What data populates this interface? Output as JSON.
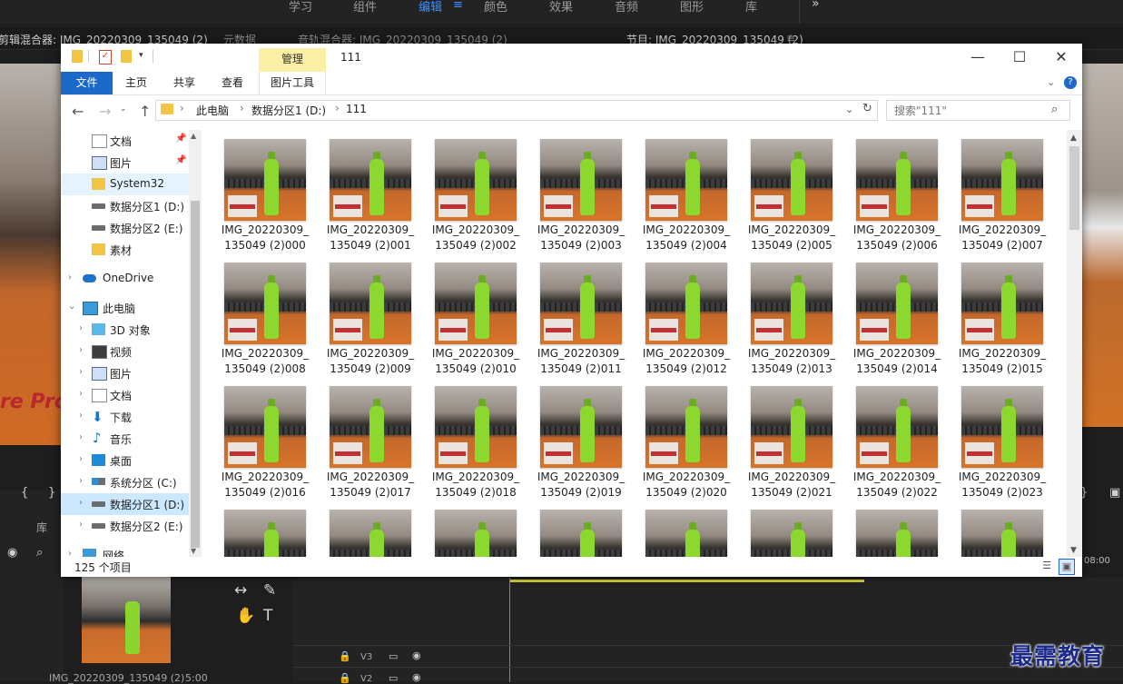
{
  "premiere": {
    "workspace_tabs": [
      "学习",
      "组件",
      "编辑",
      "颜色",
      "效果",
      "音频",
      "图形",
      "库"
    ],
    "active_workspace": "编辑",
    "more_label": "»",
    "panel_titles": {
      "effect_controls": "剪辑混合器: IMG_20220309_135049 (2)",
      "metadata": "元数据",
      "audio_mixer": "音轨混合器: IMG_20220309_135049 (2)",
      "program": "节目: IMG_20220309_135049 (2)"
    },
    "library_tab": "库",
    "project_clip_name": "IMG_20220309_135049 (2)",
    "project_clip_duration": "5:00",
    "timecode": "08:00",
    "tracks": [
      "V3",
      "V2"
    ],
    "left_text": "re Pro"
  },
  "watermark": "最需教育",
  "explorer": {
    "title": "111",
    "manage_tab": "管理",
    "ribbon_tabs": {
      "file": "文件",
      "home": "主页",
      "share": "共享",
      "view": "查看",
      "picture_tools": "图片工具"
    },
    "window_buttons": {
      "minimize": "—",
      "maximize": "☐",
      "close": "✕"
    },
    "breadcrumb": [
      "此电脑",
      "数据分区1 (D:)",
      "111"
    ],
    "search_placeholder": "搜索\"111\"",
    "nav_items": [
      {
        "label": "文档",
        "icon": "document-icon",
        "pinned": true
      },
      {
        "label": "图片",
        "icon": "picture-icon",
        "pinned": true
      },
      {
        "label": "System32",
        "icon": "folder-icon",
        "pinned": false
      },
      {
        "label": "数据分区1 (D:)",
        "icon": "drive-icon",
        "pinned": false
      },
      {
        "label": "数据分区2 (E:)",
        "icon": "drive-icon",
        "pinned": false
      },
      {
        "label": "素材",
        "icon": "folder-icon",
        "pinned": false
      },
      {
        "label": "OneDrive",
        "icon": "cloud-icon",
        "pinned": false
      },
      {
        "label": "此电脑",
        "icon": "computer-icon",
        "pinned": false
      },
      {
        "label": "3D 对象",
        "icon": "cube-icon",
        "pinned": false
      },
      {
        "label": "视频",
        "icon": "video-icon",
        "pinned": false
      },
      {
        "label": "图片",
        "icon": "picture-icon",
        "pinned": false
      },
      {
        "label": "文档",
        "icon": "document-icon",
        "pinned": false
      },
      {
        "label": "下载",
        "icon": "download-icon",
        "pinned": false
      },
      {
        "label": "音乐",
        "icon": "music-icon",
        "pinned": false
      },
      {
        "label": "桌面",
        "icon": "desktop-icon",
        "pinned": false
      },
      {
        "label": "系统分区 (C:)",
        "icon": "system-drive-icon",
        "pinned": false
      },
      {
        "label": "数据分区1 (D:)",
        "icon": "drive-icon",
        "pinned": false
      },
      {
        "label": "数据分区2 (E:)",
        "icon": "drive-icon",
        "pinned": false
      },
      {
        "label": "网络",
        "icon": "network-icon",
        "pinned": false
      }
    ],
    "files": [
      {
        "line1": "IMG_20220309_",
        "line2": "135049 (2)000"
      },
      {
        "line1": "IMG_20220309_",
        "line2": "135049 (2)001"
      },
      {
        "line1": "IMG_20220309_",
        "line2": "135049 (2)002"
      },
      {
        "line1": "IMG_20220309_",
        "line2": "135049 (2)003"
      },
      {
        "line1": "IMG_20220309_",
        "line2": "135049 (2)004"
      },
      {
        "line1": "IMG_20220309_",
        "line2": "135049 (2)005"
      },
      {
        "line1": "IMG_20220309_",
        "line2": "135049 (2)006"
      },
      {
        "line1": "IMG_20220309_",
        "line2": "135049 (2)007"
      },
      {
        "line1": "IMG_20220309_",
        "line2": "135049 (2)008"
      },
      {
        "line1": "IMG_20220309_",
        "line2": "135049 (2)009"
      },
      {
        "line1": "IMG_20220309_",
        "line2": "135049 (2)010"
      },
      {
        "line1": "IMG_20220309_",
        "line2": "135049 (2)011"
      },
      {
        "line1": "IMG_20220309_",
        "line2": "135049 (2)012"
      },
      {
        "line1": "IMG_20220309_",
        "line2": "135049 (2)013"
      },
      {
        "line1": "IMG_20220309_",
        "line2": "135049 (2)014"
      },
      {
        "line1": "IMG_20220309_",
        "line2": "135049 (2)015"
      },
      {
        "line1": "IMG_20220309_",
        "line2": "135049 (2)016"
      },
      {
        "line1": "IMG_20220309_",
        "line2": "135049 (2)017"
      },
      {
        "line1": "IMG_20220309_",
        "line2": "135049 (2)018"
      },
      {
        "line1": "IMG_20220309_",
        "line2": "135049 (2)019"
      },
      {
        "line1": "IMG_20220309_",
        "line2": "135049 (2)020"
      },
      {
        "line1": "IMG_20220309_",
        "line2": "135049 (2)021"
      },
      {
        "line1": "IMG_20220309_",
        "line2": "135049 (2)022"
      },
      {
        "line1": "IMG_20220309_",
        "line2": "135049 (2)023"
      },
      {
        "line1": "",
        "line2": ""
      },
      {
        "line1": "",
        "line2": ""
      },
      {
        "line1": "",
        "line2": ""
      },
      {
        "line1": "",
        "line2": ""
      },
      {
        "line1": "",
        "line2": ""
      },
      {
        "line1": "",
        "line2": ""
      },
      {
        "line1": "",
        "line2": ""
      },
      {
        "line1": "",
        "line2": ""
      }
    ],
    "status_count": "125 个项目",
    "colors": {
      "accent": "#1b6ac9",
      "manage_tab": "#fbeea5",
      "selected": "#cce8ff"
    }
  }
}
